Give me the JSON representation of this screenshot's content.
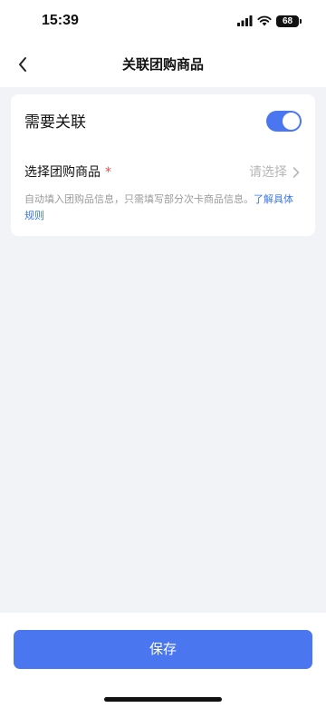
{
  "status_bar": {
    "time": "15:39",
    "battery_level": "68",
    "icons": [
      "cellular-signal-icon",
      "wifi-icon",
      "battery-icon"
    ]
  },
  "nav": {
    "back_icon": "chevron-left-icon",
    "title": "关联团购商品"
  },
  "form": {
    "toggle_label": "需要关联",
    "toggle_on": true,
    "select_label": "选择团购商品",
    "required_mark": "*",
    "select_placeholder": "请选择",
    "hint_text": "自动填入团购品信息，只需填写部分次卡商品信息。",
    "hint_link": "了解具体规则"
  },
  "footer": {
    "save_label": "保存"
  },
  "colors": {
    "accent": "#4a77f0",
    "link": "#3c78e8",
    "required": "#f04a4a",
    "background": "#f2f3f7"
  }
}
